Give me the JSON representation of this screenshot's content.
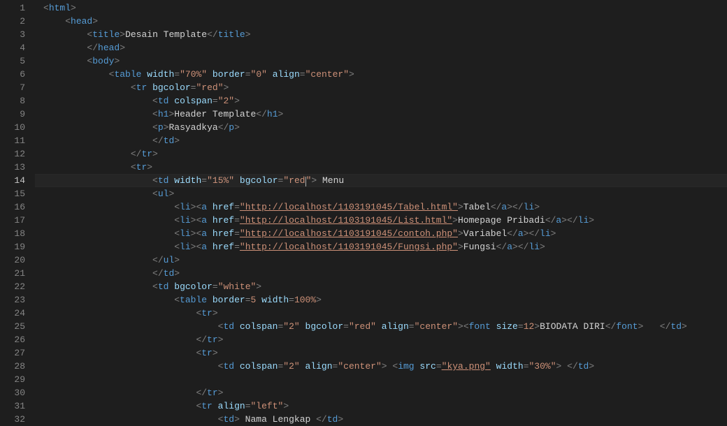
{
  "lineNumbers": [
    "1",
    "2",
    "3",
    "4",
    "5",
    "6",
    "7",
    "8",
    "9",
    "10",
    "11",
    "12",
    "13",
    "14",
    "15",
    "16",
    "17",
    "18",
    "19",
    "20",
    "21",
    "22",
    "23",
    "24",
    "25",
    "26",
    "27",
    "28",
    "29",
    "30",
    "31",
    "32"
  ],
  "activeLine": 14,
  "segments": {
    "l1": [
      [
        "p",
        "<"
      ],
      [
        "t",
        "html"
      ],
      [
        "p",
        ">"
      ]
    ],
    "l2": [
      [
        "i",
        1
      ],
      [
        "p",
        "<"
      ],
      [
        "t",
        "head"
      ],
      [
        "p",
        ">"
      ]
    ],
    "l3": [
      [
        "i",
        2
      ],
      [
        "p",
        "<"
      ],
      [
        "t",
        "title"
      ],
      [
        "p",
        ">"
      ],
      [
        "x",
        "Desain Template"
      ],
      [
        "p",
        "</"
      ],
      [
        "t",
        "title"
      ],
      [
        "p",
        ">"
      ]
    ],
    "l4": [
      [
        "i",
        2
      ],
      [
        "p",
        "</"
      ],
      [
        "t",
        "head"
      ],
      [
        "p",
        ">"
      ]
    ],
    "l5": [
      [
        "i",
        2
      ],
      [
        "p",
        "<"
      ],
      [
        "t",
        "body"
      ],
      [
        "p",
        ">"
      ]
    ],
    "l6": [
      [
        "i",
        3
      ],
      [
        "p",
        "<"
      ],
      [
        "t",
        "table"
      ],
      [
        "x",
        " "
      ],
      [
        "a",
        "width"
      ],
      [
        "p",
        "="
      ],
      [
        "s",
        "\"70%\""
      ],
      [
        "x",
        " "
      ],
      [
        "a",
        "border"
      ],
      [
        "p",
        "="
      ],
      [
        "s",
        "\"0\""
      ],
      [
        "x",
        " "
      ],
      [
        "a",
        "align"
      ],
      [
        "p",
        "="
      ],
      [
        "s",
        "\"center\""
      ],
      [
        "p",
        ">"
      ]
    ],
    "l7": [
      [
        "i",
        4
      ],
      [
        "p",
        "<"
      ],
      [
        "t",
        "tr"
      ],
      [
        "x",
        " "
      ],
      [
        "a",
        "bgcolor"
      ],
      [
        "p",
        "="
      ],
      [
        "s",
        "\"red\""
      ],
      [
        "p",
        ">"
      ]
    ],
    "l8": [
      [
        "i",
        5
      ],
      [
        "p",
        "<"
      ],
      [
        "t",
        "td"
      ],
      [
        "x",
        " "
      ],
      [
        "a",
        "colspan"
      ],
      [
        "p",
        "="
      ],
      [
        "s",
        "\"2\""
      ],
      [
        "p",
        ">"
      ]
    ],
    "l9": [
      [
        "i",
        5
      ],
      [
        "p",
        "<"
      ],
      [
        "t",
        "h1"
      ],
      [
        "p",
        ">"
      ],
      [
        "x",
        "Header Template"
      ],
      [
        "p",
        "</"
      ],
      [
        "t",
        "h1"
      ],
      [
        "p",
        ">"
      ]
    ],
    "l10": [
      [
        "i",
        5
      ],
      [
        "p",
        "<"
      ],
      [
        "t",
        "p"
      ],
      [
        "p",
        ">"
      ],
      [
        "x",
        "Rasyadkya"
      ],
      [
        "p",
        "</"
      ],
      [
        "t",
        "p"
      ],
      [
        "p",
        ">"
      ]
    ],
    "l11": [
      [
        "i",
        5
      ],
      [
        "p",
        "</"
      ],
      [
        "t",
        "td"
      ],
      [
        "p",
        ">"
      ]
    ],
    "l12": [
      [
        "i",
        4
      ],
      [
        "p",
        "</"
      ],
      [
        "t",
        "tr"
      ],
      [
        "p",
        ">"
      ]
    ],
    "l13": [
      [
        "i",
        4
      ],
      [
        "p",
        "<"
      ],
      [
        "t",
        "tr"
      ],
      [
        "p",
        ">"
      ]
    ],
    "l14": [
      [
        "i",
        5
      ],
      [
        "p",
        "<"
      ],
      [
        "t",
        "td"
      ],
      [
        "x",
        " "
      ],
      [
        "a",
        "width"
      ],
      [
        "p",
        "="
      ],
      [
        "s",
        "\"15%\""
      ],
      [
        "x",
        " "
      ],
      [
        "a",
        "bgcolor"
      ],
      [
        "p",
        "="
      ],
      [
        "s",
        "\"red"
      ],
      [
        "c",
        ""
      ],
      [
        "s",
        "\""
      ],
      [
        "p",
        ">"
      ],
      [
        "x",
        " Menu"
      ]
    ],
    "l15": [
      [
        "i",
        5
      ],
      [
        "p",
        "<"
      ],
      [
        "t",
        "ul"
      ],
      [
        "p",
        ">"
      ]
    ],
    "l16": [
      [
        "i",
        6
      ],
      [
        "p",
        "<"
      ],
      [
        "t",
        "li"
      ],
      [
        "p",
        "><"
      ],
      [
        "t",
        "a"
      ],
      [
        "x",
        " "
      ],
      [
        "a",
        "href"
      ],
      [
        "p",
        "="
      ],
      [
        "u",
        "\"http://localhost/1103191045/Tabel.html\""
      ],
      [
        "p",
        ">"
      ],
      [
        "x",
        "Tabel"
      ],
      [
        "p",
        "</"
      ],
      [
        "t",
        "a"
      ],
      [
        "p",
        "></"
      ],
      [
        "t",
        "li"
      ],
      [
        "p",
        ">"
      ]
    ],
    "l17": [
      [
        "i",
        6
      ],
      [
        "p",
        "<"
      ],
      [
        "t",
        "li"
      ],
      [
        "p",
        "><"
      ],
      [
        "t",
        "a"
      ],
      [
        "x",
        " "
      ],
      [
        "a",
        "href"
      ],
      [
        "p",
        "="
      ],
      [
        "u",
        "\"http://localhost/1103191045/List.html\""
      ],
      [
        "p",
        ">"
      ],
      [
        "x",
        "Homepage Pribadi"
      ],
      [
        "p",
        "</"
      ],
      [
        "t",
        "a"
      ],
      [
        "p",
        "></"
      ],
      [
        "t",
        "li"
      ],
      [
        "p",
        ">"
      ]
    ],
    "l18": [
      [
        "i",
        6
      ],
      [
        "p",
        "<"
      ],
      [
        "t",
        "li"
      ],
      [
        "p",
        "><"
      ],
      [
        "t",
        "a"
      ],
      [
        "x",
        " "
      ],
      [
        "a",
        "href"
      ],
      [
        "p",
        "="
      ],
      [
        "u",
        "\"http://localhost/1103191045/contoh.php\""
      ],
      [
        "p",
        ">"
      ],
      [
        "x",
        "Variabel"
      ],
      [
        "p",
        "</"
      ],
      [
        "t",
        "a"
      ],
      [
        "p",
        "></"
      ],
      [
        "t",
        "li"
      ],
      [
        "p",
        ">"
      ]
    ],
    "l19": [
      [
        "i",
        6
      ],
      [
        "p",
        "<"
      ],
      [
        "t",
        "li"
      ],
      [
        "p",
        "><"
      ],
      [
        "t",
        "a"
      ],
      [
        "x",
        " "
      ],
      [
        "a",
        "href"
      ],
      [
        "p",
        "="
      ],
      [
        "u",
        "\"http://localhost/1103191045/Fungsi.php\""
      ],
      [
        "p",
        ">"
      ],
      [
        "x",
        "Fungsi"
      ],
      [
        "p",
        "</"
      ],
      [
        "t",
        "a"
      ],
      [
        "p",
        "></"
      ],
      [
        "t",
        "li"
      ],
      [
        "p",
        ">"
      ]
    ],
    "l20": [
      [
        "i",
        5
      ],
      [
        "p",
        "</"
      ],
      [
        "t",
        "ul"
      ],
      [
        "p",
        ">"
      ]
    ],
    "l21": [
      [
        "i",
        5
      ],
      [
        "p",
        "</"
      ],
      [
        "t",
        "td"
      ],
      [
        "p",
        ">"
      ]
    ],
    "l22": [
      [
        "i",
        5
      ],
      [
        "p",
        "<"
      ],
      [
        "t",
        "td"
      ],
      [
        "x",
        " "
      ],
      [
        "a",
        "bgcolor"
      ],
      [
        "p",
        "="
      ],
      [
        "s",
        "\"white\""
      ],
      [
        "p",
        ">"
      ]
    ],
    "l23": [
      [
        "i",
        6
      ],
      [
        "p",
        "<"
      ],
      [
        "t",
        "table"
      ],
      [
        "x",
        " "
      ],
      [
        "a",
        "border"
      ],
      [
        "p",
        "="
      ],
      [
        "s",
        "5"
      ],
      [
        "x",
        " "
      ],
      [
        "a",
        "width"
      ],
      [
        "p",
        "="
      ],
      [
        "s",
        "100%"
      ],
      [
        "p",
        ">"
      ]
    ],
    "l24": [
      [
        "i",
        7
      ],
      [
        "p",
        "<"
      ],
      [
        "t",
        "tr"
      ],
      [
        "p",
        ">"
      ]
    ],
    "l25": [
      [
        "i",
        8
      ],
      [
        "p",
        "<"
      ],
      [
        "t",
        "td"
      ],
      [
        "x",
        " "
      ],
      [
        "a",
        "colspan"
      ],
      [
        "p",
        "="
      ],
      [
        "s",
        "\"2\""
      ],
      [
        "x",
        " "
      ],
      [
        "a",
        "bgcolor"
      ],
      [
        "p",
        "="
      ],
      [
        "s",
        "\"red\""
      ],
      [
        "x",
        " "
      ],
      [
        "a",
        "align"
      ],
      [
        "p",
        "="
      ],
      [
        "s",
        "\"center\""
      ],
      [
        "p",
        "><"
      ],
      [
        "t",
        "font"
      ],
      [
        "x",
        " "
      ],
      [
        "a",
        "size"
      ],
      [
        "p",
        "="
      ],
      [
        "s",
        "12"
      ],
      [
        "p",
        ">"
      ],
      [
        "x",
        "BIODATA DIRI"
      ],
      [
        "p",
        "</"
      ],
      [
        "t",
        "font"
      ],
      [
        "p",
        ">"
      ],
      [
        "x",
        "   "
      ],
      [
        "p",
        "</"
      ],
      [
        "t",
        "td"
      ],
      [
        "p",
        ">"
      ]
    ],
    "l26": [
      [
        "i",
        7
      ],
      [
        "p",
        "</"
      ],
      [
        "t",
        "tr"
      ],
      [
        "p",
        ">"
      ]
    ],
    "l27": [
      [
        "i",
        7
      ],
      [
        "p",
        "<"
      ],
      [
        "t",
        "tr"
      ],
      [
        "p",
        ">"
      ]
    ],
    "l28": [
      [
        "i",
        8
      ],
      [
        "p",
        "<"
      ],
      [
        "t",
        "td"
      ],
      [
        "x",
        " "
      ],
      [
        "a",
        "colspan"
      ],
      [
        "p",
        "="
      ],
      [
        "s",
        "\"2\""
      ],
      [
        "x",
        " "
      ],
      [
        "a",
        "align"
      ],
      [
        "p",
        "="
      ],
      [
        "s",
        "\"center\""
      ],
      [
        "p",
        ">"
      ],
      [
        "x",
        " "
      ],
      [
        "p",
        "<"
      ],
      [
        "t",
        "img"
      ],
      [
        "x",
        " "
      ],
      [
        "a",
        "src"
      ],
      [
        "p",
        "="
      ],
      [
        "u",
        "\"kya.png\""
      ],
      [
        "x",
        " "
      ],
      [
        "a",
        "width"
      ],
      [
        "p",
        "="
      ],
      [
        "s",
        "\"30%\""
      ],
      [
        "p",
        ">"
      ],
      [
        "x",
        " "
      ],
      [
        "p",
        "</"
      ],
      [
        "t",
        "td"
      ],
      [
        "p",
        ">"
      ]
    ],
    "l29": [
      [
        "x",
        ""
      ]
    ],
    "l30": [
      [
        "i",
        7
      ],
      [
        "p",
        "</"
      ],
      [
        "t",
        "tr"
      ],
      [
        "p",
        ">"
      ]
    ],
    "l31": [
      [
        "i",
        7
      ],
      [
        "p",
        "<"
      ],
      [
        "t",
        "tr"
      ],
      [
        "x",
        " "
      ],
      [
        "a",
        "align"
      ],
      [
        "p",
        "="
      ],
      [
        "s",
        "\"left\""
      ],
      [
        "p",
        ">"
      ]
    ],
    "l32": [
      [
        "i",
        8
      ],
      [
        "p",
        "<"
      ],
      [
        "t",
        "td"
      ],
      [
        "p",
        ">"
      ],
      [
        "x",
        " Nama Lengkap "
      ],
      [
        "p",
        "</"
      ],
      [
        "t",
        "td"
      ],
      [
        "p",
        ">"
      ]
    ]
  }
}
